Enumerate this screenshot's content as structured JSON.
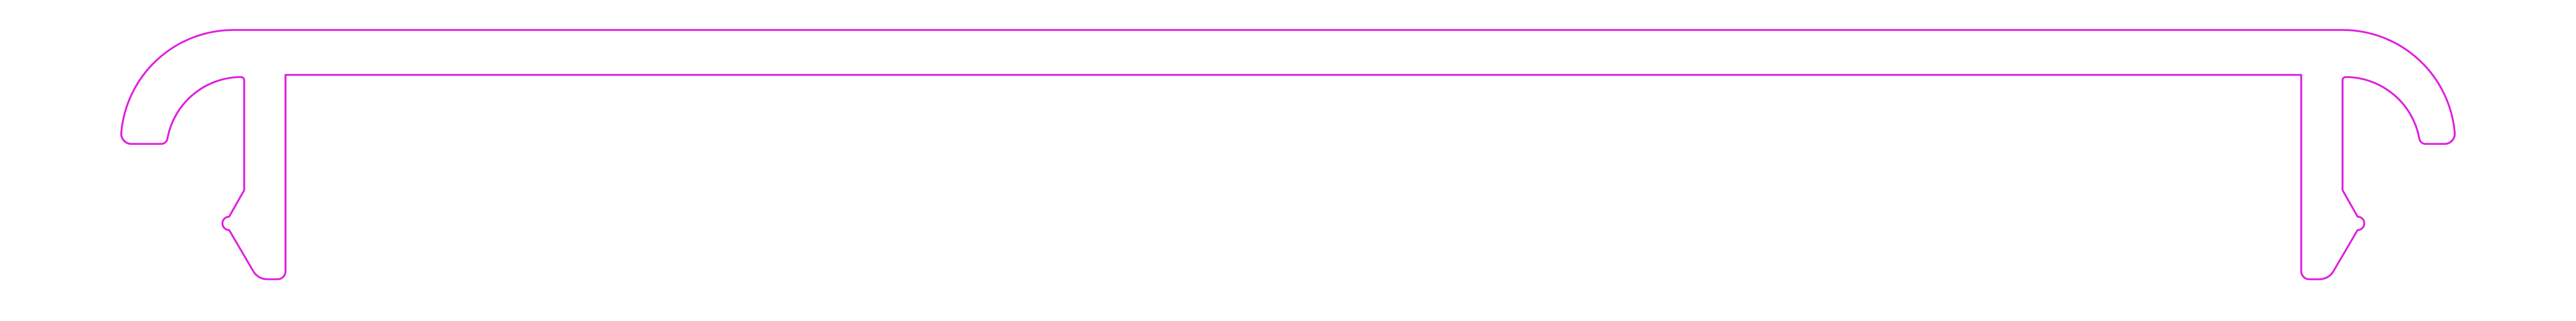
{
  "drawing": {
    "stroke_color": "#e020e0",
    "background_color": "#ffffff"
  }
}
